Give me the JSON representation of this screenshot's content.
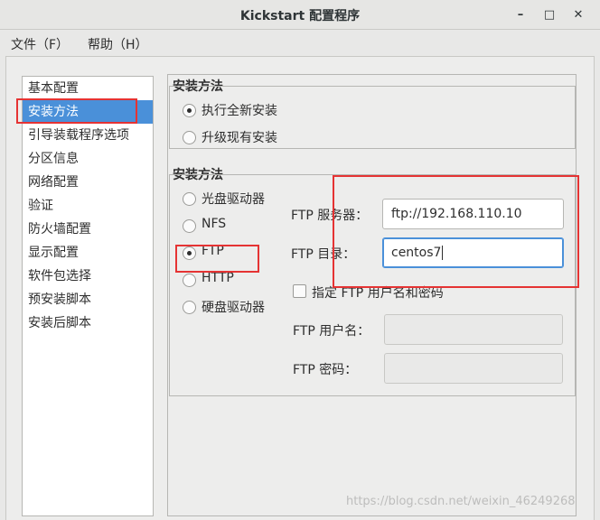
{
  "window": {
    "title": "Kickstart 配置程序",
    "buttons": {
      "minimize": "–",
      "maximize": "□",
      "close": "✕"
    }
  },
  "menu": [
    "文件（F）",
    "帮助（H）"
  ],
  "sidebar": {
    "items": [
      "基本配置",
      "安装方法",
      "引导装载程序选项",
      "分区信息",
      "网络配置",
      "验证",
      "防火墙配置",
      "显示配置",
      "软件包选择",
      "预安装脚本",
      "安装后脚本"
    ],
    "selected": "安装方法"
  },
  "install_method": {
    "title": "安装方法",
    "options": [
      "执行全新安装",
      "升级现有安装"
    ],
    "selected": "执行全新安装"
  },
  "install_source": {
    "title": "安装方法",
    "options": [
      "光盘驱动器",
      "NFS",
      "FTP",
      "HTTP",
      "硬盘驱动器"
    ],
    "selected": "FTP",
    "ftp": {
      "server_label": "FTP 服务器：",
      "server_value": "ftp://192.168.110.10",
      "dir_label": "FTP 目录：",
      "dir_value": "centos7",
      "specify_user_label": "指定 FTP 用户名和密码",
      "specify_user_checked": false,
      "user_label": "FTP 用户名：",
      "user_value": "",
      "password_label": "FTP 密码：",
      "password_value": ""
    }
  },
  "annotations": {
    "highlight_color": "#e53333",
    "accent_color": "#4a90d9"
  },
  "watermark": "https://blog.csdn.net/weixin_46249268"
}
